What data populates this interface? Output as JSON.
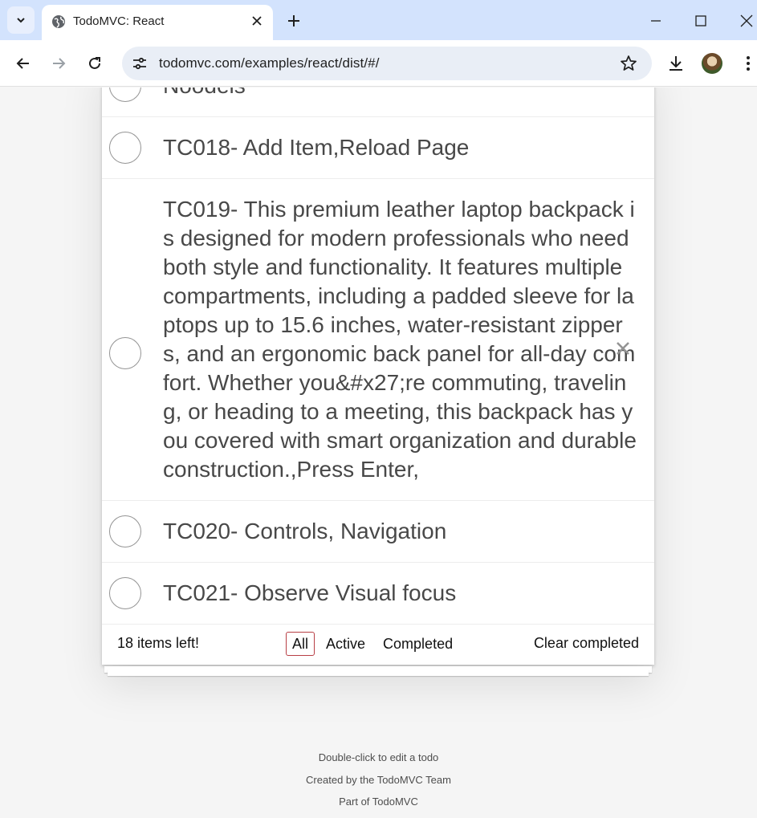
{
  "browser": {
    "tab_title": "TodoMVC: React",
    "url": "todomvc.com/examples/react/dist/#/"
  },
  "todos": [
    {
      "label": "Noodels"
    },
    {
      "label": "TC018- Add Item,Reload Page"
    },
    {
      "label": "TC019- This premium leather laptop backpack is designed for modern professionals who need both style and functionality. It features multiple compartments, including a padded sleeve for laptops up to 15.6 inches, water-resistant zippers, and an ergonomic back panel for all-day comfort. Whether you&#x27;re commuting, traveling, or heading to a meeting, this backpack has you covered with smart organization and durable construction.,Press Enter,"
    },
    {
      "label": "TC020- Controls, Navigation"
    },
    {
      "label": "TC021- Observe Visual focus"
    }
  ],
  "footer": {
    "count": "18 items left!",
    "filter_all": "All",
    "filter_active": "Active",
    "filter_completed": "Completed",
    "clear": "Clear completed"
  },
  "info": {
    "line1": "Double-click to edit a todo",
    "line2": "Created by the TodoMVC Team",
    "line3": "Part of TodoMVC"
  },
  "colors": {
    "tabbar": "#d3e3fd",
    "filter_border": "#b83f45",
    "page_bg": "#f5f5f5"
  }
}
